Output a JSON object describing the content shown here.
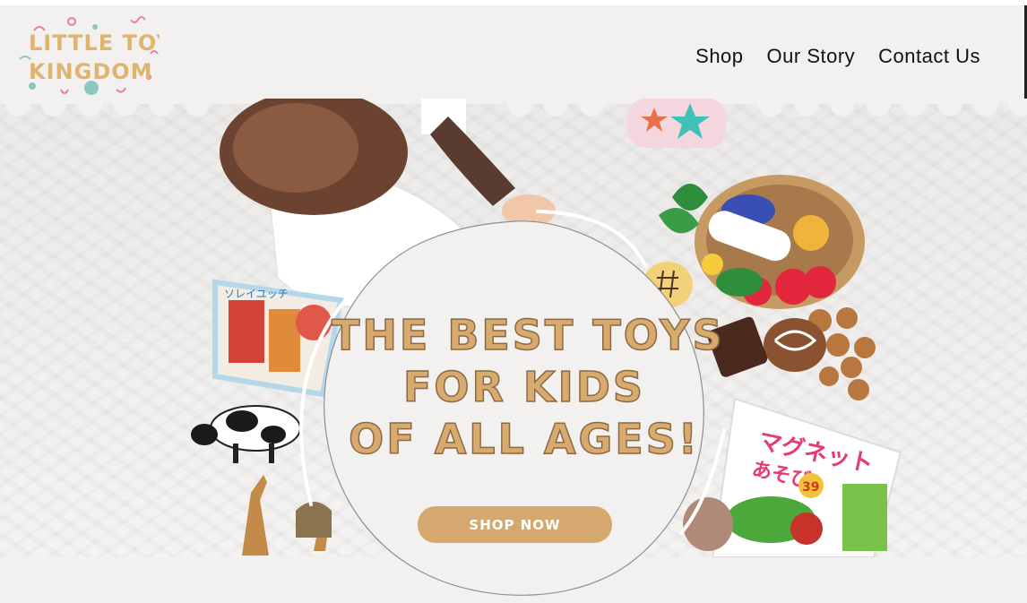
{
  "brand": {
    "logo_line1": "LITTLE TOY",
    "logo_line2": "KINGDOM"
  },
  "nav": {
    "items": [
      {
        "label": "Shop"
      },
      {
        "label": "Our Story"
      },
      {
        "label": "Contact Us"
      }
    ]
  },
  "hero": {
    "headline_line1": "THE BEST TOYS",
    "headline_line2": "FOR KIDS",
    "headline_line3": "OF ALL AGES!",
    "cta_label": "SHOP NOW",
    "book_left_text": "ソレイユッチ",
    "book_right_text1": "マグネット",
    "book_right_text2": "あそび",
    "book_right_badge": "39"
  },
  "colors": {
    "accent": "#d4a86e",
    "background": "#f2f1ef",
    "text": "#111111"
  }
}
